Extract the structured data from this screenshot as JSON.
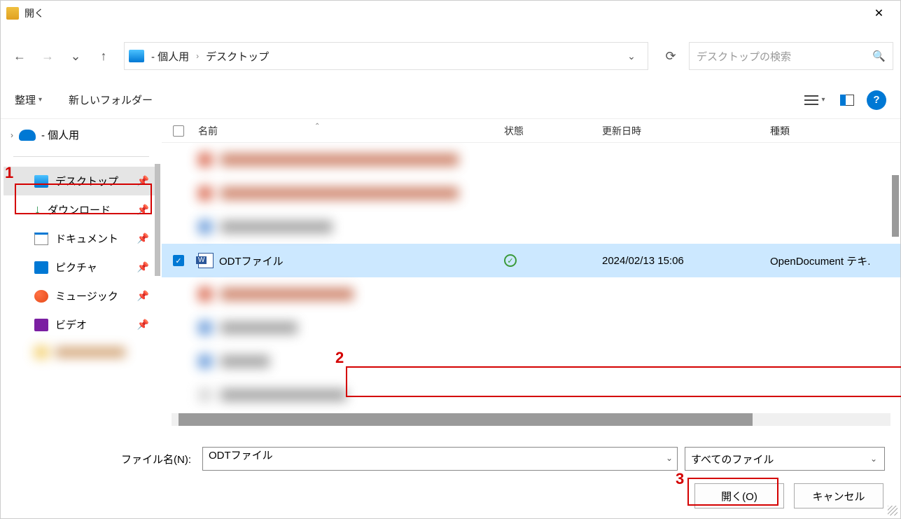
{
  "titlebar": {
    "title": "開く"
  },
  "nav": {
    "breadcrumb": {
      "user": "- 個人用",
      "location": "デスクトップ"
    },
    "search_placeholder": "デスクトップの検索"
  },
  "toolbar": {
    "organize": "整理",
    "new_folder": "新しいフォルダー"
  },
  "sidebar": {
    "top_label": "- 個人用",
    "items": [
      {
        "label": "デスクトップ",
        "icon": "desktop",
        "pinned": true,
        "selected": true
      },
      {
        "label": "ダウンロード",
        "icon": "download",
        "pinned": true,
        "selected": false
      },
      {
        "label": "ドキュメント",
        "icon": "document",
        "pinned": true,
        "selected": false
      },
      {
        "label": "ピクチャ",
        "icon": "picture",
        "pinned": true,
        "selected": false
      },
      {
        "label": "ミュージック",
        "icon": "music",
        "pinned": true,
        "selected": false
      },
      {
        "label": "ビデオ",
        "icon": "video",
        "pinned": true,
        "selected": false
      }
    ]
  },
  "columns": {
    "name": "名前",
    "state": "状態",
    "date": "更新日時",
    "type": "種類"
  },
  "selected_file": {
    "name": "ODTファイル",
    "date": "2024/02/13 15:06",
    "type": "OpenDocument テキ.",
    "checked": true
  },
  "footer": {
    "filename_label": "ファイル名(N):",
    "filename_value": "ODTファイル",
    "filter_value": "すべてのファイル",
    "open_label": "開く(O)",
    "cancel_label": "キャンセル"
  },
  "annotations": {
    "n1": "1",
    "n2": "2",
    "n3": "3"
  }
}
